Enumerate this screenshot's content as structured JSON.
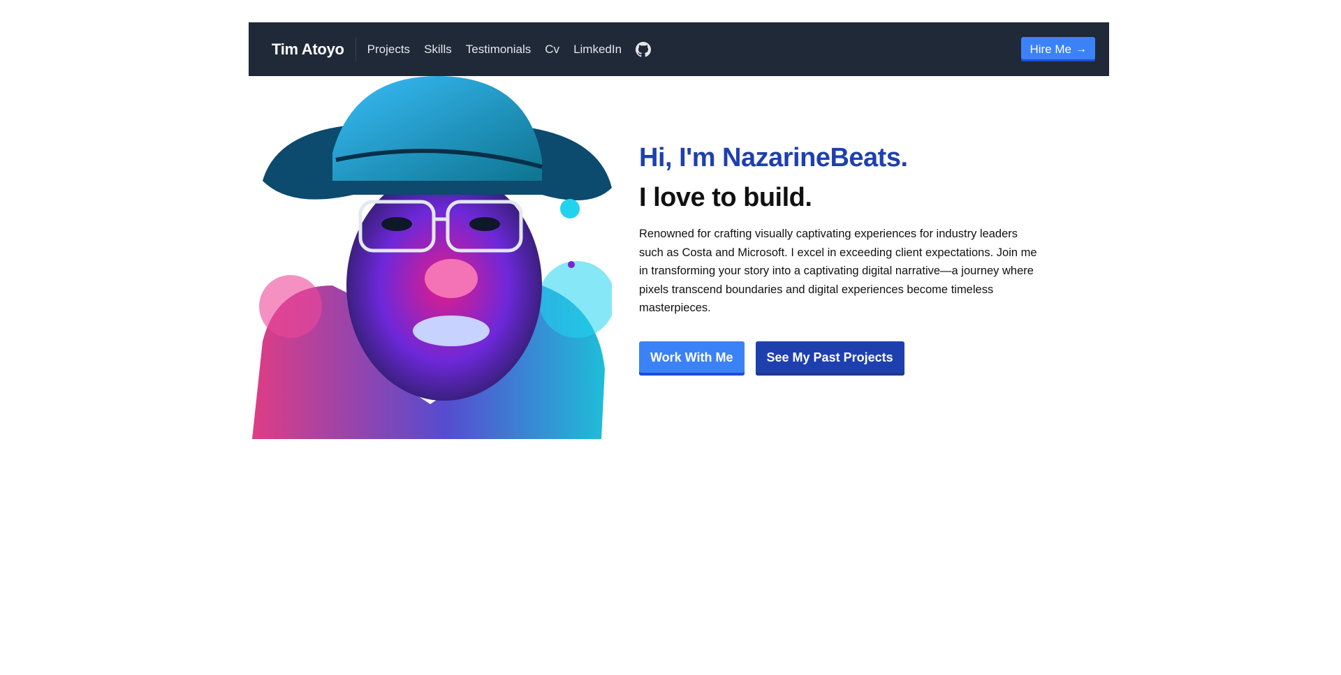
{
  "nav": {
    "brand": "Tim Atoyo",
    "links": [
      "Projects",
      "Skills",
      "Testimonials",
      "Cv",
      "LimkedIn"
    ],
    "hire_label": "Hire Me",
    "hire_icon": "arrow-right-icon",
    "github_icon": "github-icon",
    "bg_color": "#1f2937",
    "accent_color": "#3b82f6"
  },
  "hero": {
    "greeting": "Hi, I'm NazarineBeats.",
    "tagline": "I love to build.",
    "bio": "Renowned for crafting visually captivating experiences for industry leaders such as Costa and Microsoft. I excel in exceeding client expectations. Join me in transforming your story into a captivating digital narrative—a journey where pixels transcend boundaries and digital experiences become timeless masterpieces.",
    "primary_cta": "Work With Me",
    "secondary_cta": "See My Past Projects",
    "greeting_color": "#1e40af"
  },
  "portrait": {
    "icon": "portrait-illustration"
  }
}
